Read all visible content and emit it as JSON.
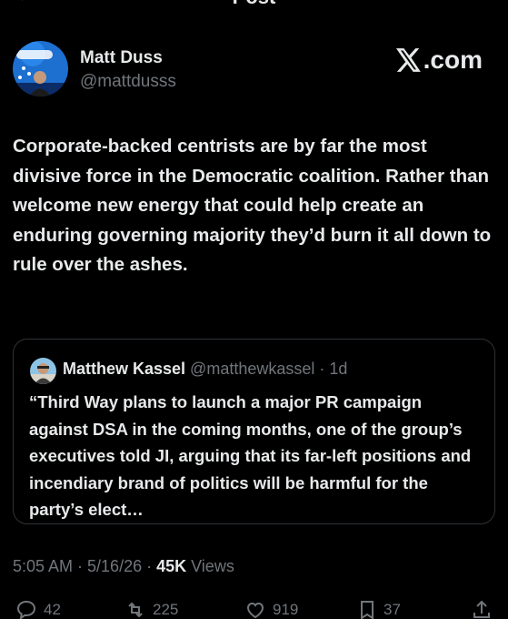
{
  "header": {
    "title": "Post"
  },
  "author": {
    "name": "Matt Duss",
    "handle": "@mattdusss",
    "avatar_badge": "Foreign Policy"
  },
  "source_logo": {
    "label": ".com"
  },
  "tweet": {
    "text": "Corporate-backed centrists are by far the most divisive force in the Democratic coalition. Rather than welcome new energy that could help create an enduring governing majority they’d burn it all down to rule over the ashes."
  },
  "quote": {
    "name": "Matthew Kassel",
    "handle_time": " @matthewkassel · 1d",
    "text": "“Third Way plans to launch a major PR campaign against DSA in the coming months, one of the group’s executives told JI, arguing that its far-left positions and incendiary brand of politics will be harmful for the party’s elect…"
  },
  "meta": {
    "timestamp": "5:05 AM · 5/16/26 · ",
    "views_count": "45K",
    "views_label": " Views"
  },
  "actions": {
    "replies": "42",
    "reposts": "225",
    "likes": "919",
    "bookmarks": "37"
  },
  "colors": {
    "background": "#000000",
    "text": "#e7e9ea",
    "muted": "#71767b",
    "border": "#2f3336"
  }
}
